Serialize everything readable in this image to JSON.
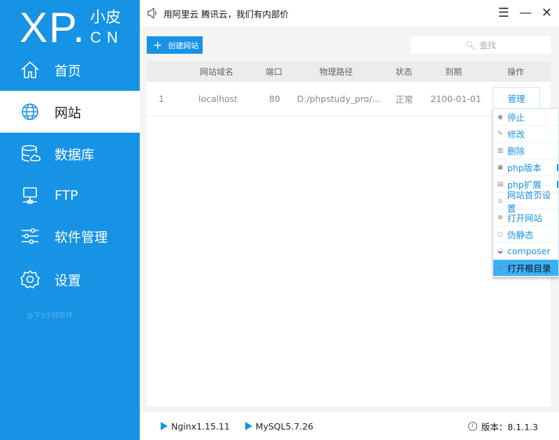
{
  "logo": {
    "main": "XP.",
    "sub1": "小皮",
    "sub2": "CN"
  },
  "sidebar": {
    "items": [
      {
        "label": "首页",
        "icon": "home-icon"
      },
      {
        "label": "网站",
        "icon": "globe-icon"
      },
      {
        "label": "数据库",
        "icon": "database-icon"
      },
      {
        "label": "FTP",
        "icon": "ftp-icon"
      },
      {
        "label": "软件管理",
        "icon": "sliders-icon"
      },
      {
        "label": "设置",
        "icon": "gear-icon"
      }
    ],
    "active": 1,
    "watermark": "@下1个好软件"
  },
  "header": {
    "notice": "用阿里云 腾讯云，我们有内部价"
  },
  "toolbar": {
    "create_label": "创建网站",
    "search_placeholder": "查找"
  },
  "table": {
    "columns": [
      "网站域名",
      "端口",
      "物理路径",
      "状态",
      "到期",
      "操作"
    ],
    "rows": [
      {
        "index": "1",
        "domain": "localhost",
        "port": "80",
        "path": "D:/phpstudy_pro/...",
        "status": "正常",
        "expire": "2100-01-01",
        "action": "管理"
      }
    ]
  },
  "menu": {
    "items": [
      {
        "label": "停止",
        "icon": "stop-icon"
      },
      {
        "label": "修改",
        "icon": "pencil-icon"
      },
      {
        "label": "删除",
        "icon": "trash-icon"
      },
      {
        "label": "php版本",
        "icon": "php-version-icon",
        "submenu": true
      },
      {
        "label": "php扩展",
        "icon": "php-extension-icon",
        "submenu": true
      },
      {
        "label": "网站首页设置",
        "icon": "home-icon"
      },
      {
        "label": "打开网站",
        "icon": "globe-icon"
      },
      {
        "label": "伪静态",
        "icon": "ring-icon"
      },
      {
        "label": "composer",
        "icon": "composer-icon"
      },
      {
        "label": "打开根目录",
        "icon": "list-icon",
        "highlighted": true
      }
    ]
  },
  "footer": {
    "services": [
      "Nginx1.15.11",
      "MySQL5.7.26"
    ],
    "version": "版本：8.1.1.3"
  }
}
